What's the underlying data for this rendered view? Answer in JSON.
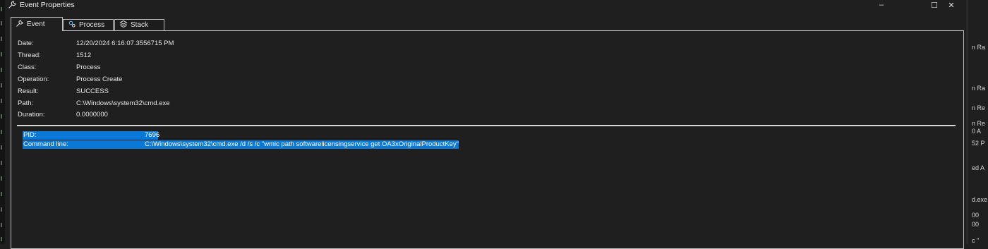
{
  "window": {
    "title": "Event Properties",
    "controls": [
      "–",
      "☐",
      "✕"
    ]
  },
  "tabs": [
    {
      "label": "Event",
      "icon": "wrench-icon",
      "active": true
    },
    {
      "label": "Process",
      "icon": "gears-icon",
      "active": false
    },
    {
      "label": "Stack",
      "icon": "stack-icon",
      "active": false
    }
  ],
  "event": {
    "date": {
      "label": "Date:",
      "value": "12/20/2024 6:16:07.3556715 PM"
    },
    "thread": {
      "label": "Thread:",
      "value": "1512"
    },
    "class": {
      "label": "Class:",
      "value": "Process"
    },
    "operation": {
      "label": "Operation:",
      "value": "Process Create"
    },
    "result": {
      "label": "Result:",
      "value": "SUCCESS"
    },
    "path": {
      "label": "Path:",
      "value": "C:\\Windows\\system32\\cmd.exe"
    },
    "duration": {
      "label": "Duration:",
      "value": "0.0000000"
    }
  },
  "details": {
    "pid": {
      "label": "PID:",
      "value": "7696"
    },
    "command_line": {
      "label": "Command line:",
      "value": "C:\\Windows\\system32\\cmd.exe /d /s /c \"wmic path softwarelicensingservice get OA3xOriginalProductKey\""
    }
  },
  "background_window_fragments": [
    "n Ra",
    "n Ra",
    "n Re",
    "n Re",
    "0 A",
    "52 P",
    "ed A",
    "d.exe",
    "00",
    "00",
    "c \""
  ],
  "colors": {
    "background": "#1f1f1f",
    "selection": "#0a78d7",
    "text": "#e6e6e6",
    "border": "#bdbdbd"
  }
}
